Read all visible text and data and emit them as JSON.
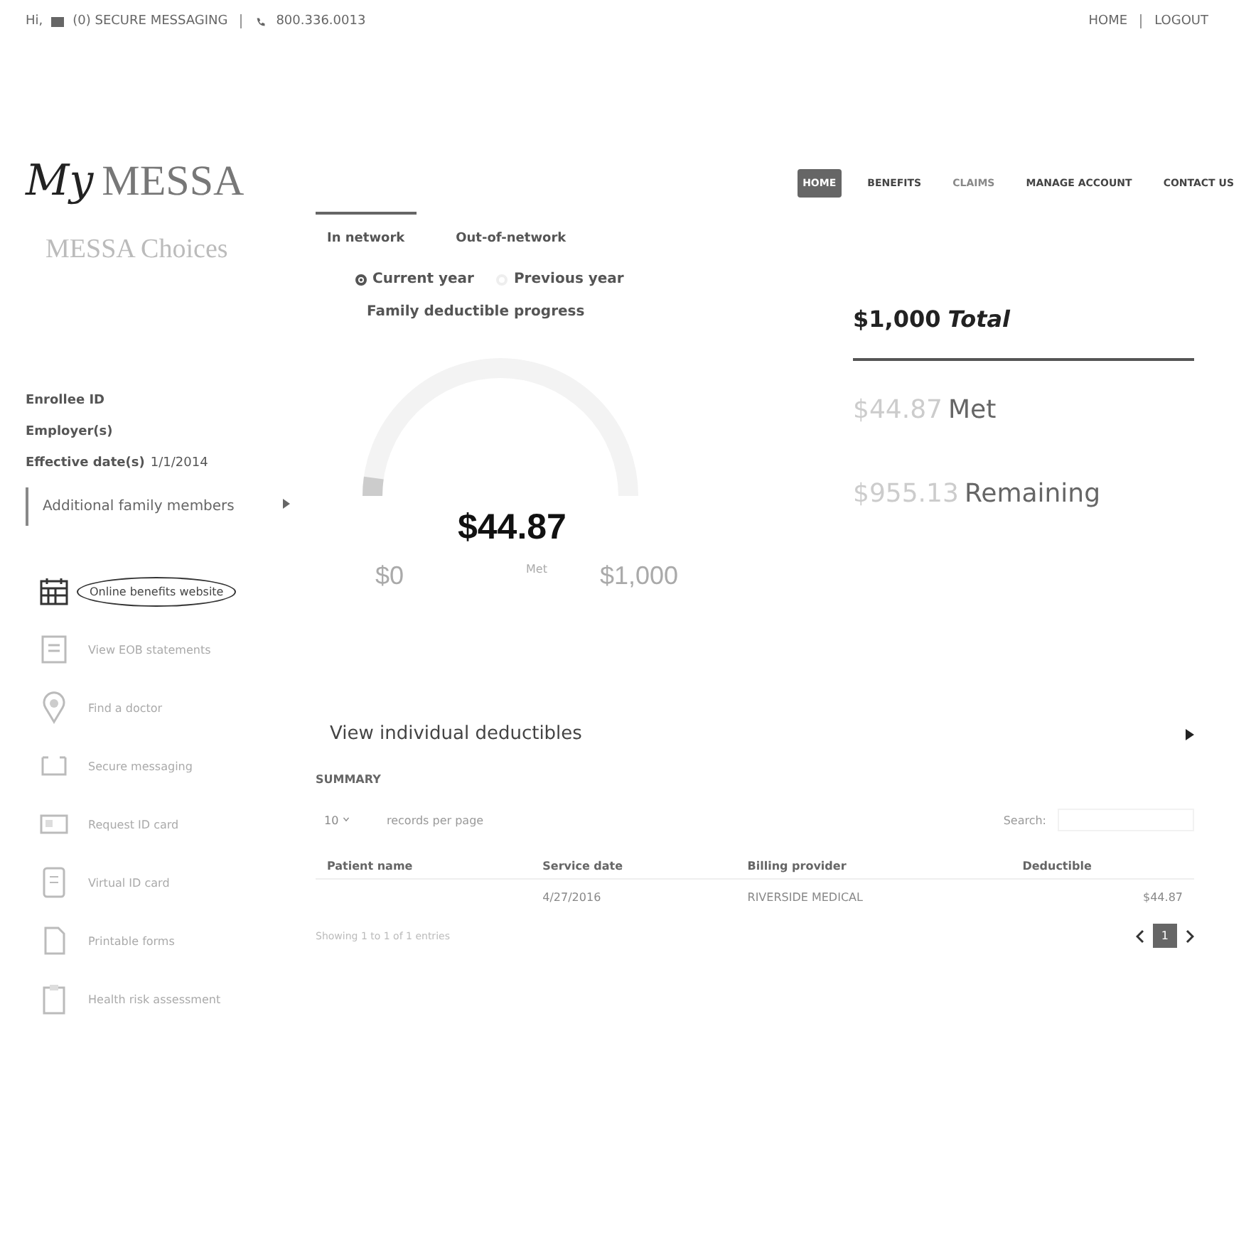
{
  "top_bar": {
    "greeting": "Hi,",
    "messages": "(0) SECURE MESSAGING",
    "phone": "800.336.0013",
    "links": [
      "HOME",
      "LOGOUT"
    ]
  },
  "logo": {
    "script": "My",
    "word": "MESSA"
  },
  "nav": [
    {
      "label": "HOME",
      "selected": true
    },
    {
      "label": "BENEFITS",
      "selected": false
    },
    {
      "label": "CLAIMS",
      "selected": false
    },
    {
      "label": "MANAGE ACCOUNT",
      "selected": false
    },
    {
      "label": "CONTACT US",
      "selected": false
    }
  ],
  "sidebar": {
    "plan": "MESSA Choices",
    "fields": [
      {
        "label": "Enrollee ID"
      },
      {
        "label": "Employer(s)"
      },
      {
        "label": "Effective date(s)",
        "value": "1/1/2014"
      }
    ],
    "family": "Additional family members",
    "items": [
      {
        "label": "Online benefits website",
        "circled": true
      },
      {
        "label": "View EOB statements",
        "circled": false
      },
      {
        "label": "Find a doctor",
        "circled": false
      },
      {
        "label": "Secure messaging",
        "circled": false
      },
      {
        "label": "Request ID card",
        "circled": false
      },
      {
        "label": "Virtual ID card",
        "circled": false
      },
      {
        "label": "Printable forms",
        "circled": false
      },
      {
        "label": "Health risk assessment",
        "circled": false
      }
    ]
  },
  "network_tabs": [
    {
      "label": "In network",
      "selected": true
    },
    {
      "label": "Out-of-network",
      "selected": false
    }
  ],
  "year_options": [
    {
      "label": "Current year",
      "selected": true
    },
    {
      "label": "Previous year",
      "selected": false
    }
  ],
  "progress_title": "Family deductible progress",
  "gauge": {
    "level": 0.045,
    "amount": "$44.87",
    "min": "$0",
    "caption": "Met",
    "max": "$1,000"
  },
  "summary_box": {
    "total": "$1,000",
    "total_word": "Total",
    "met_amount": "$44.87",
    "met_word": "Met",
    "remaining_amount": "$955.13",
    "remaining_word": "Remaining"
  },
  "individual_link": "View individual deductibles",
  "table": {
    "title": "SUMMARY",
    "page_size": "10",
    "page_size_label": "records per page",
    "search_label": "Search:",
    "columns": [
      "Patient name",
      "Service date",
      "Billing provider",
      "Deductible"
    ],
    "rows": [
      [
        "",
        "4/27/2016",
        "RIVERSIDE MEDICAL",
        "$44.87"
      ]
    ],
    "info": "Showing 1 to 1 of 1 entries",
    "pages": [
      {
        "label": "1",
        "selected": true
      }
    ]
  }
}
